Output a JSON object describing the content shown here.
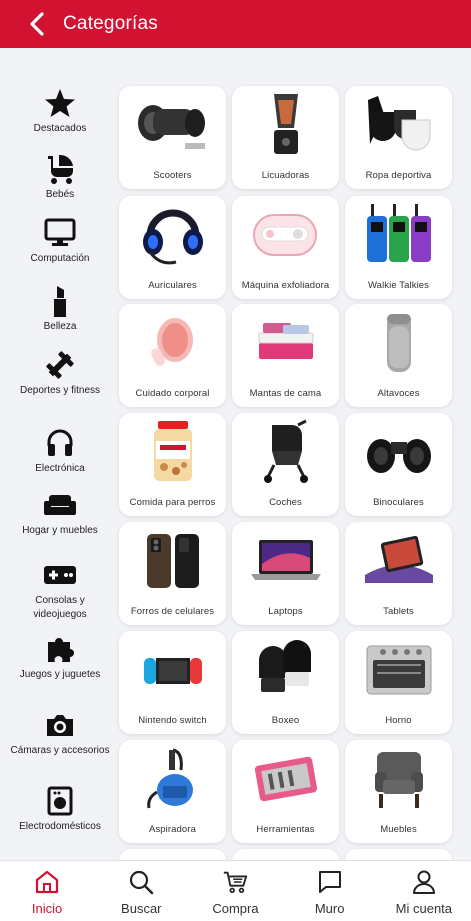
{
  "header": {
    "title": "Categorías"
  },
  "sidebar": {
    "items": [
      {
        "label": "Destacados",
        "icon": "star-icon"
      },
      {
        "label": "Bebés",
        "icon": "stroller-icon"
      },
      {
        "label": "Computación",
        "icon": "monitor-icon"
      },
      {
        "label": "Belleza",
        "icon": "lipstick-icon"
      },
      {
        "label": "Deportes y fitness",
        "icon": "dumbbell-icon"
      },
      {
        "label": "Electrónica",
        "icon": "headphones-icon"
      },
      {
        "label": "Hogar y muebles",
        "icon": "sofa-icon"
      },
      {
        "label": "Consolas y videojuegos",
        "icon": "gamepad-icon"
      },
      {
        "label": "Juegos y juguetes",
        "icon": "puzzle-icon"
      },
      {
        "label": "Cámaras y accesorios",
        "icon": "camera-icon"
      },
      {
        "label": "Electrodomésticos",
        "icon": "washing-machine-icon"
      }
    ]
  },
  "grid": {
    "cards": [
      {
        "label": "Scooters",
        "icon": "hoverboard-image"
      },
      {
        "label": "Licuadoras",
        "icon": "blender-image"
      },
      {
        "label": "Ropa deportiva",
        "icon": "sports-bra-image"
      },
      {
        "label": "Auriculares",
        "icon": "gaming-headset-image"
      },
      {
        "label": "Máquina exfoliadora",
        "icon": "exfoliator-image"
      },
      {
        "label": "Walkie Talkies",
        "icon": "walkie-talkie-image"
      },
      {
        "label": "Cuidado corporal",
        "icon": "body-brush-image"
      },
      {
        "label": "Mantas de cama",
        "icon": "bed-sheets-image"
      },
      {
        "label": "Altavoces",
        "icon": "speaker-image"
      },
      {
        "label": "Comida para perros",
        "icon": "dog-treats-image"
      },
      {
        "label": "Coches",
        "icon": "baby-stroller-image"
      },
      {
        "label": "Binoculares",
        "icon": "binoculars-image"
      },
      {
        "label": "Forros de celulares",
        "icon": "phone-case-image"
      },
      {
        "label": "Laptops",
        "icon": "laptop-image"
      },
      {
        "label": "Tablets",
        "icon": "tablet-stand-image"
      },
      {
        "label": "Nintendo switch",
        "icon": "nintendo-switch-image"
      },
      {
        "label": "Boxeo",
        "icon": "boxing-gloves-image"
      },
      {
        "label": "Horno",
        "icon": "toaster-oven-image"
      },
      {
        "label": "Aspiradora",
        "icon": "vacuum-image"
      },
      {
        "label": "Herramientas",
        "icon": "toolkit-image"
      },
      {
        "label": "Muebles",
        "icon": "armchair-image"
      }
    ]
  },
  "bottom_nav": {
    "items": [
      {
        "label": "Inicio",
        "icon": "home-icon",
        "active": true
      },
      {
        "label": "Buscar",
        "icon": "search-icon"
      },
      {
        "label": "Compra",
        "icon": "cart-icon"
      },
      {
        "label": "Muro",
        "icon": "chat-icon"
      },
      {
        "label": "Mi cuenta",
        "icon": "user-icon"
      }
    ]
  },
  "colors": {
    "brand": "#d11231",
    "background": "#f1f3f6"
  }
}
